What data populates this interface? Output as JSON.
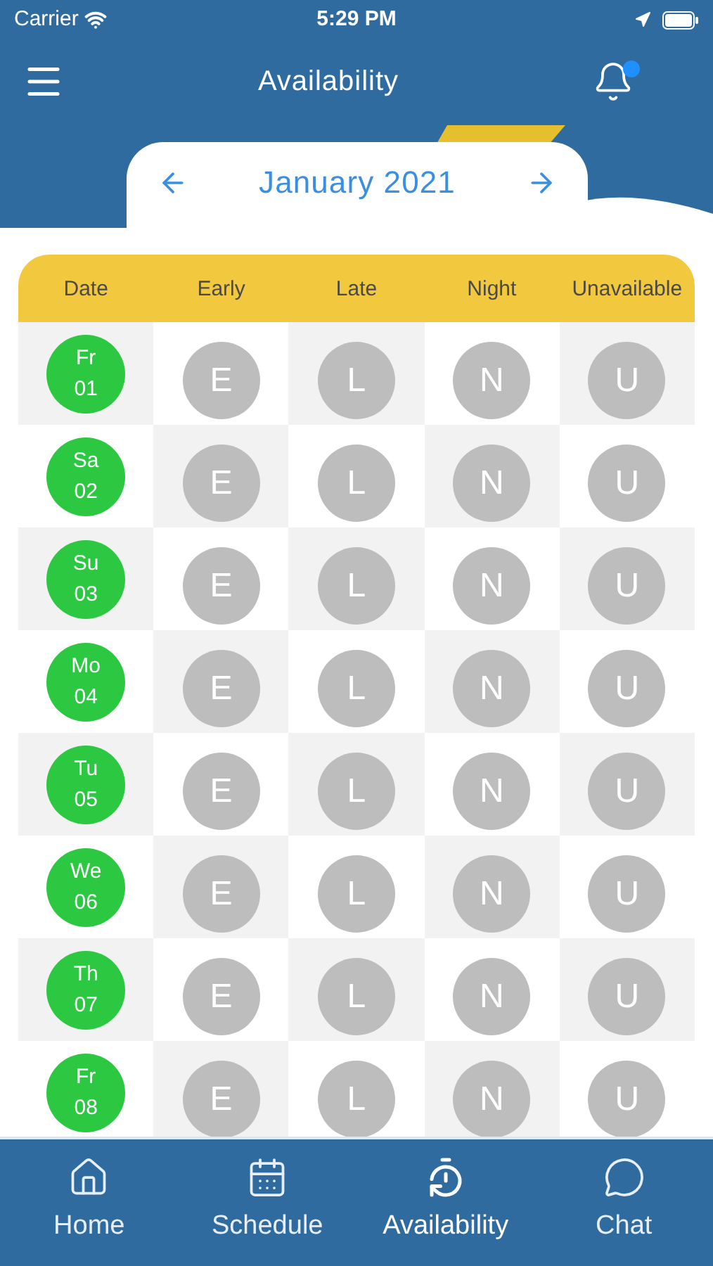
{
  "status_bar": {
    "carrier": "Carrier",
    "time": "5:29 PM"
  },
  "header": {
    "title": "Availability",
    "has_notification": true
  },
  "month_nav": {
    "label": "January 2021"
  },
  "table": {
    "columns": [
      "Date",
      "Early",
      "Late",
      "Night",
      "Unavailable"
    ],
    "rows": [
      {
        "day": "Fr",
        "date": "01",
        "shifts": [
          {
            "label": "E",
            "selected": false
          },
          {
            "label": "L",
            "selected": false
          },
          {
            "label": "N",
            "selected": false
          },
          {
            "label": "U",
            "selected": false
          }
        ]
      },
      {
        "day": "Sa",
        "date": "02",
        "shifts": [
          {
            "label": "E",
            "selected": false
          },
          {
            "label": "L",
            "selected": false
          },
          {
            "label": "N",
            "selected": false
          },
          {
            "label": "U",
            "selected": false
          }
        ]
      },
      {
        "day": "Su",
        "date": "03",
        "shifts": [
          {
            "label": "E",
            "selected": false
          },
          {
            "label": "L",
            "selected": false
          },
          {
            "label": "N",
            "selected": false
          },
          {
            "label": "U",
            "selected": false
          }
        ]
      },
      {
        "day": "Mo",
        "date": "04",
        "shifts": [
          {
            "label": "E",
            "selected": false
          },
          {
            "label": "L",
            "selected": false
          },
          {
            "label": "N",
            "selected": false
          },
          {
            "label": "U",
            "selected": false
          }
        ]
      },
      {
        "day": "Tu",
        "date": "05",
        "shifts": [
          {
            "label": "E",
            "selected": false
          },
          {
            "label": "L",
            "selected": false
          },
          {
            "label": "N",
            "selected": false
          },
          {
            "label": "U",
            "selected": false
          }
        ]
      },
      {
        "day": "We",
        "date": "06",
        "shifts": [
          {
            "label": "E",
            "selected": false
          },
          {
            "label": "L",
            "selected": false
          },
          {
            "label": "N",
            "selected": false
          },
          {
            "label": "U",
            "selected": false
          }
        ]
      },
      {
        "day": "Th",
        "date": "07",
        "shifts": [
          {
            "label": "E",
            "selected": false
          },
          {
            "label": "L",
            "selected": false
          },
          {
            "label": "N",
            "selected": false
          },
          {
            "label": "U",
            "selected": false
          }
        ]
      },
      {
        "day": "Fr",
        "date": "08",
        "shifts": [
          {
            "label": "E",
            "selected": false
          },
          {
            "label": "L",
            "selected": false
          },
          {
            "label": "N",
            "selected": false
          },
          {
            "label": "U",
            "selected": false
          }
        ]
      }
    ]
  },
  "tab_bar": [
    {
      "label": "Home",
      "selected": false
    },
    {
      "label": "Schedule",
      "selected": false
    },
    {
      "label": "Availability",
      "selected": true
    },
    {
      "label": "Chat",
      "selected": false
    }
  ]
}
